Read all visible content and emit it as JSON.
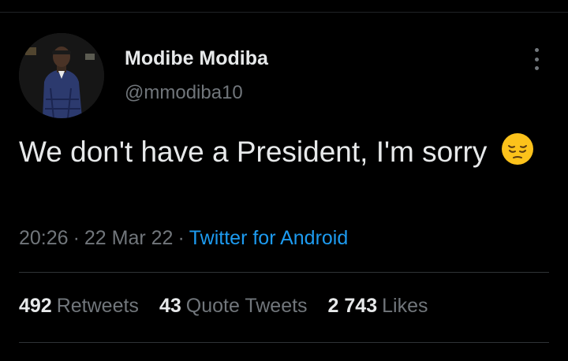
{
  "tweet": {
    "author": {
      "display_name": "Modibe Modiba",
      "handle": "@mmodiba10"
    },
    "text": "We don't have a President,  I'm sorry",
    "emoji": "pensive-face",
    "meta": {
      "time": "20:26",
      "separator": "·",
      "date": "22 Mar 22",
      "source": "Twitter for Android"
    },
    "stats": {
      "retweets": {
        "count": "492",
        "label": "Retweets"
      },
      "quotes": {
        "count": "43",
        "label": "Quote Tweets"
      },
      "likes": {
        "count": "2 743",
        "label": "Likes"
      }
    }
  },
  "icons": {
    "more": "more-vertical-icon"
  },
  "colors": {
    "background": "#000000",
    "text_primary": "#e7e9ea",
    "text_secondary": "#71767b",
    "link": "#1d9bf0",
    "divider": "#2f3336"
  }
}
